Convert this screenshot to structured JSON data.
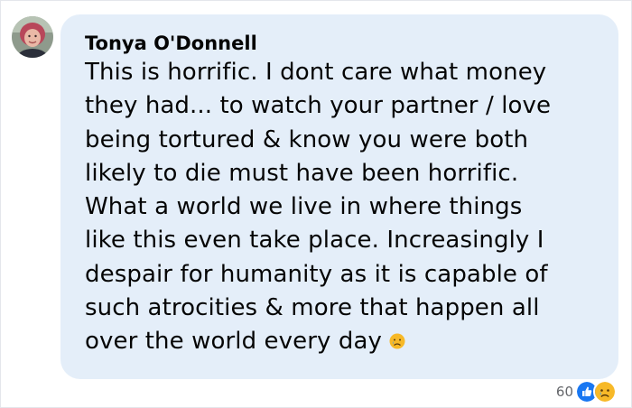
{
  "comment": {
    "author": "Tonya O'Donnell",
    "lines": [
      "This is horrific. I dont care what money",
      "they had... to watch your partner / love",
      "being tortured & know you were both",
      "likely to die must have been horrific.",
      "What a world we live in where things",
      "like this even take place. Increasingly I",
      "despair for humanity as it is capable of",
      "such atrocities & more that happen all",
      "over the world every day"
    ],
    "inline_emoji": "crying-face-emoji"
  },
  "reactions": {
    "count": "60",
    "icons": [
      "like-icon",
      "sad-face-icon"
    ]
  },
  "colors": {
    "bubble": "#e4eef9",
    "text": "#050505",
    "meta": "#65676b",
    "like_blue": "#1877f2",
    "emoji_yellow": "#f7b928"
  }
}
